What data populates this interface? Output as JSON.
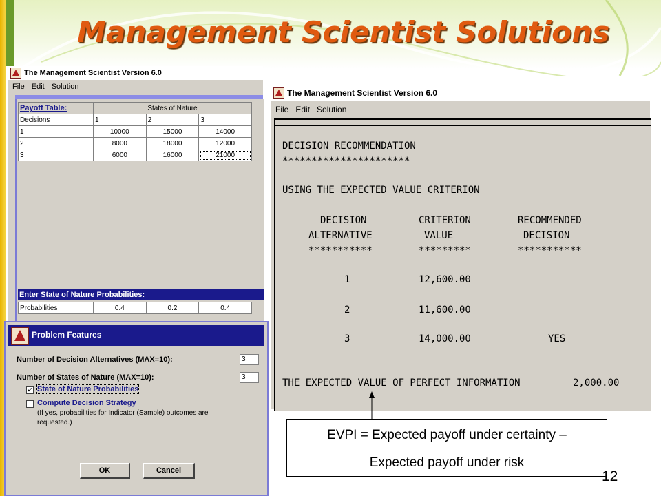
{
  "slide": {
    "title": "Management Scientist Solutions",
    "page_number": "12"
  },
  "payoff_window": {
    "title": "The Management Scientist Version 6.0",
    "menu": [
      "File",
      "Edit",
      "Solution"
    ],
    "payoff_table_label": "Payoff Table:",
    "states_header": "States of Nature",
    "decisions_header": "Decisions",
    "state_columns": [
      "1",
      "2",
      "3"
    ],
    "rows": [
      {
        "decision": "1",
        "values": [
          "10000",
          "15000",
          "14000"
        ]
      },
      {
        "decision": "2",
        "values": [
          "8000",
          "18000",
          "12000"
        ]
      },
      {
        "decision": "3",
        "values": [
          "6000",
          "16000",
          "21000"
        ]
      }
    ],
    "probabilities_label": "Enter State of Nature Probabilities:",
    "probabilities_row_label": "Probabilities",
    "probabilities": [
      "0.4",
      "0.2",
      "0.4"
    ]
  },
  "report_window": {
    "title": "The Management Scientist Version 6.0",
    "menu": [
      "File",
      "Edit",
      "Solution"
    ],
    "heading": "DECISION RECOMMENDATION",
    "stars_heading": "**********************",
    "criterion_line": "USING THE EXPECTED VALUE CRITERION",
    "col_headers_1": [
      "DECISION",
      "CRITERION",
      "RECOMMENDED"
    ],
    "col_headers_2": [
      "ALTERNATIVE",
      "VALUE",
      "DECISION"
    ],
    "col_stars": [
      "***********",
      "*********",
      "***********"
    ],
    "results": [
      {
        "alternative": "1",
        "value": "12,600.00",
        "recommended": ""
      },
      {
        "alternative": "2",
        "value": "11,600.00",
        "recommended": ""
      },
      {
        "alternative": "3",
        "value": "14,000.00",
        "recommended": "YES"
      }
    ],
    "evpi_label": "THE EXPECTED VALUE OF PERFECT INFORMATION",
    "evpi_value": "2,000.00"
  },
  "features_dialog": {
    "title": "Problem Features",
    "alternatives_label": "Number of Decision Alternatives (MAX=10):",
    "alternatives_value": "3",
    "states_label": "Number of States of Nature (MAX=10):",
    "states_value": "3",
    "option_probabilities": "State of Nature Probabilities",
    "option_probabilities_checked": true,
    "option_strategy": "Compute Decision Strategy",
    "option_strategy_checked": false,
    "strategy_note": "(If yes, probabilities for Indicator (Sample) outcomes are requested.)",
    "ok_label": "OK",
    "cancel_label": "Cancel"
  },
  "callout": {
    "line1": "EVPI = Expected payoff under certainty –",
    "line2": "Expected payoff under risk"
  }
}
